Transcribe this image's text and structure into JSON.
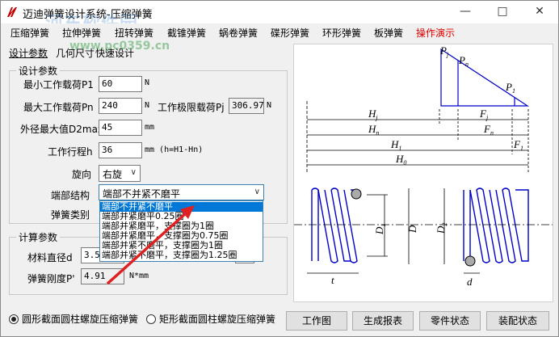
{
  "window": {
    "title": "迈迪弹簧设计系统-压缩弹簧",
    "watermark": "河东软件园",
    "watermark_url": "www.pc0359.cn"
  },
  "menu": [
    "压缩弹簧",
    "拉伸弹簧",
    "扭转弹簧",
    "截锥弹簧",
    "蜗卷弹簧",
    "碟形弹簧",
    "环形弹簧",
    "板弹簧",
    "操作演示"
  ],
  "tabs": [
    "设计参数",
    "几何尺寸",
    "快速设计"
  ],
  "design_params": {
    "title": "设计参数",
    "min_load_label": "最小工作载荷P1",
    "min_load": "60",
    "min_load_unit": "N",
    "max_load_label": "最大工作载荷Pn",
    "max_load": "240",
    "max_load_unit": "N",
    "limit_load_label": "工作极限载荷Pj",
    "limit_load": "306.97",
    "limit_load_unit": "N",
    "outer_dia_label": "外径最大值D2max",
    "outer_dia": "45",
    "outer_dia_unit": "mm",
    "stroke_label": "工作行程h",
    "stroke": "36",
    "stroke_unit": "mm (h=H1-Hn)",
    "rotation_label": "旋向",
    "rotation": "右旋",
    "end_label": "端部结构",
    "end_value": "端部不并紧不磨平",
    "type_label": "弹簧类别"
  },
  "end_options": [
    "端部不并紧不磨平",
    "端部并紧磨平0.25圈",
    "端部并紧磨平，支撑圈为1圈",
    "端部并紧磨平，支撑圈为0.75圈",
    "端部并紧不磨平，支撑圈为1圈",
    "端部并紧不磨平，支撑圈为1.25圈"
  ],
  "calc_params": {
    "title": "计算参数",
    "wire_dia_label": "材料直径d",
    "wire_dia": "3.5",
    "stiffness_label": "弹簧刚度P'",
    "stiffness": "4.91",
    "stiffness_unit": "N*mm"
  },
  "diagram_labels": {
    "Pj": "P",
    "Pj_sub": "j",
    "Pn": "P",
    "Pn_sub": "n",
    "P1": "P",
    "P1_sub": "1",
    "Hj": "H",
    "Hj_sub": "j",
    "Fj": "F",
    "Fj_sub": "j",
    "Hn": "H",
    "Hn_sub": "n",
    "Fn": "F",
    "Fn_sub": "n",
    "H1": "H",
    "H1_sub": "1",
    "F1": "F",
    "F1_sub": "1",
    "H0": "H",
    "H0_sub": "0",
    "D1": "D",
    "D1_sub": "1",
    "D": "D",
    "D2": "D",
    "D2_sub": "2",
    "t": "t",
    "d": "d"
  },
  "bottom": {
    "radio1": "圆形截面圆柱螺旋压缩弹簧",
    "radio2": "矩形截面圆柱螺旋压缩弹簧",
    "btn_drawing": "工作图",
    "btn_report": "生成报表",
    "btn_part_state": "零件状态",
    "btn_assembly_state": "装配状态"
  },
  "colors": {
    "spring_blue": "#0000cc",
    "selection": "#0078d7",
    "menu_red": "#e00000"
  }
}
